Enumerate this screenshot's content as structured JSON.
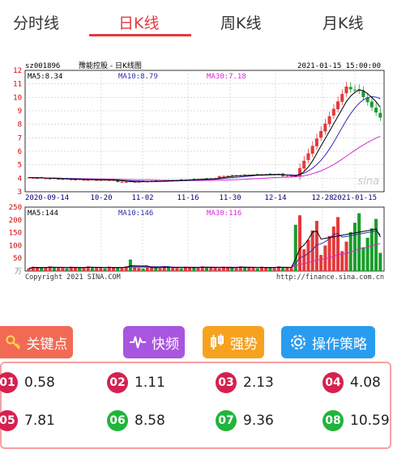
{
  "tabs": [
    {
      "label": "分时线"
    },
    {
      "label": "日K线"
    },
    {
      "label": "周K线"
    },
    {
      "label": "月K线"
    }
  ],
  "chart": {
    "code": "sz001896",
    "name": "豫能控股 - 日K线图",
    "datetime": "2021-01-15 15:00:00",
    "ma_price": {
      "ma5": "MA5:8.34",
      "ma10": "MA10:8.79",
      "ma30": "MA30:7.18"
    },
    "ma_volume": {
      "ma5": "MA5:144",
      "ma10": "MA10:146",
      "ma30": "MA30:116"
    },
    "price_ticks": [
      "3",
      "4",
      "5",
      "6",
      "7",
      "8",
      "9",
      "10",
      "11",
      "12"
    ],
    "volume_ticks": [
      "万",
      "50",
      "100",
      "150",
      "200",
      "250"
    ],
    "date_ticks": [
      "2020-09-14",
      "10-20",
      "11-02",
      "11-16",
      "11-30",
      "12-14",
      "12-28",
      "2021-01-15"
    ],
    "copyright": "Copyright 2021 SINA.COM",
    "url": "http://finance.sina.com.cn",
    "watermark": "sina",
    "colors": {
      "up": "#e4393c",
      "down": "#1a9d2b",
      "ma5": "#000000",
      "ma10": "#2f2fb0",
      "ma30": "#d52ad5"
    }
  },
  "chart_data": {
    "type": "candlestick",
    "title": "豫能控股 - 日K线图",
    "y_range": [
      3,
      12
    ],
    "volume_range": [
      0,
      250
    ],
    "x_ticks": [
      "2020-09-14",
      "10-20",
      "11-02",
      "11-16",
      "11-30",
      "12-14",
      "12-28",
      "2021-01-15"
    ],
    "legend": [
      "MA5:8.34",
      "MA10:8.79",
      "MA30:7.18"
    ],
    "volume_legend": [
      "MA5:144",
      "MA10:146",
      "MA30:116"
    ]
  },
  "toolbar": {
    "key_points": "关键点",
    "fast": "快频",
    "strong": "强势",
    "strategy": "操作策略"
  },
  "key_points": [
    {
      "n": "01",
      "v": "0.58"
    },
    {
      "n": "02",
      "v": "1.11"
    },
    {
      "n": "03",
      "v": "2.13"
    },
    {
      "n": "04",
      "v": "4.08"
    },
    {
      "n": "05",
      "v": "7.81"
    },
    {
      "n": "06",
      "v": "8.58"
    },
    {
      "n": "07",
      "v": "9.36"
    },
    {
      "n": "08",
      "v": "10.59"
    }
  ]
}
